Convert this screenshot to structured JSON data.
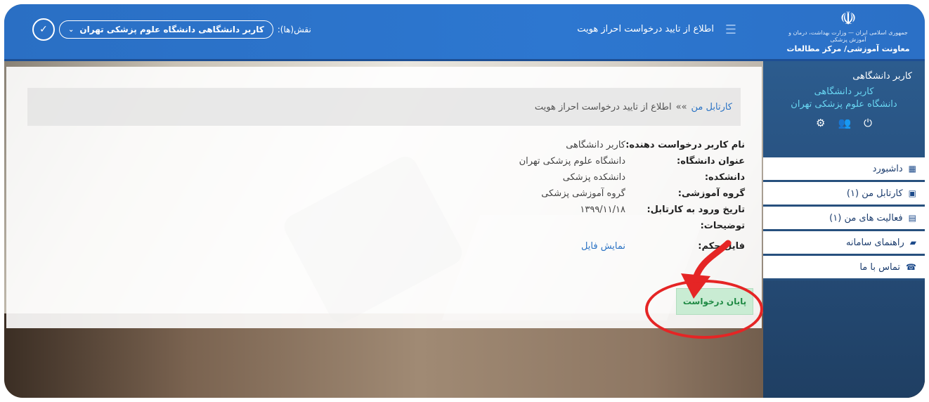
{
  "header": {
    "brand_sub": "جمهوری اسلامی ایران — وزارت بهداشت، درمان و آموزش پزشکی",
    "brand_title": "معاونت آموزشی/ مرکز مطالعات",
    "page_title": "اطلاع از تایید درخواست احراز هویت",
    "roles_label": "نقش(ها):",
    "role_selected": "کاربر دانشگاهی دانشگاه علوم پزشکی تهران",
    "confirm_icon": "check-icon"
  },
  "sidebar": {
    "role": "کاربر دانشگاهی",
    "user_line1": "کاربر دانشگاهی",
    "user_line2": "دانشگاه علوم پزشکی تهران",
    "icons": [
      "power-icon",
      "users-icon",
      "gear-icon"
    ],
    "items": [
      {
        "label": "داشبورد",
        "icon": "dashboard-icon"
      },
      {
        "label": "کارتابل من (۱)",
        "icon": "inbox-icon"
      },
      {
        "label": "فعالیت های من (۱)",
        "icon": "activity-icon"
      },
      {
        "label": "راهنمای سامانه",
        "icon": "book-icon"
      },
      {
        "label": "تماس با ما",
        "icon": "phone-icon"
      }
    ]
  },
  "breadcrumb": {
    "root": "کارتابل من",
    "sep": "»»",
    "current": "اطلاع از تایید درخواست احراز هویت"
  },
  "details": {
    "requester_label": "نام کاربر درخواست دهنده:",
    "requester_value": "کاربر دانشگاهی",
    "university_label": "عنوان دانشگاه:",
    "university_value": "دانشگاه علوم پزشکی تهران",
    "faculty_label": "دانشکده:",
    "faculty_value": "دانشکده پزشکی",
    "group_label": "گروه آموزشی:",
    "group_value": "گروه آموزشی پزشکی",
    "date_label": "تاریخ ورود به کارتابل:",
    "date_value": "۱۳۹۹/۱۱/۱۸",
    "notes_label": "توضیحات:",
    "file_label": "فایل حکم:",
    "file_link": "نمایش فایل"
  },
  "actions": {
    "finish": "پایان درخواست"
  },
  "colors": {
    "header": "#2d77d0",
    "sidebar": "#27507e",
    "link": "#2b73c4",
    "finish_bg": "#c9ecd3",
    "annotation": "#e52525"
  }
}
